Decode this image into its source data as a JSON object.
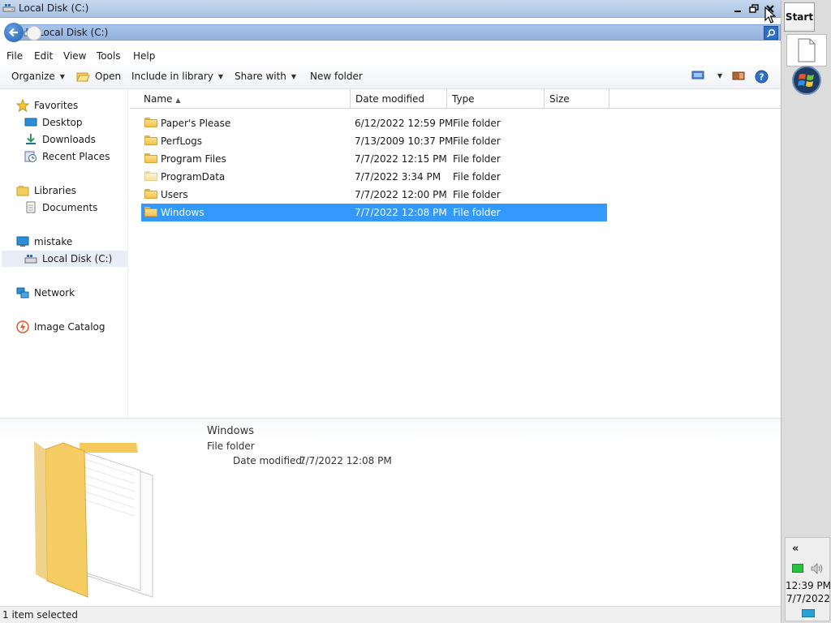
{
  "window": {
    "title": "Local Disk (C:)",
    "controls": {
      "minimize_icon": "minimize-icon",
      "maximize_icon": "restore-icon",
      "close_icon": "close-icon"
    }
  },
  "address": {
    "path": "Local Disk (C:)",
    "back_icon": "back-arrow-icon",
    "search_icon": "search-icon"
  },
  "menu": {
    "items": [
      "File",
      "Edit",
      "View",
      "Tools",
      "Help"
    ]
  },
  "toolbar": {
    "organize": "Organize",
    "open": "Open",
    "include_in_library": "Include in library",
    "share_with": "Share with",
    "new_folder": "New folder"
  },
  "nav": {
    "favorites": "Favorites",
    "desktop": "Desktop",
    "downloads": "Downloads",
    "recent_places": "Recent Places",
    "libraries": "Libraries",
    "documents": "Documents",
    "computer": "mistake",
    "local_disk": "Local Disk (C:)",
    "network": "Network",
    "image_catalog": "Image Catalog"
  },
  "columns": {
    "name": "Name",
    "date": "Date modified",
    "type": "Type",
    "size": "Size"
  },
  "files": [
    {
      "name": "Paper's Please",
      "date": "6/12/2022 12:59 PM",
      "type": "File folder"
    },
    {
      "name": "PerfLogs",
      "date": "7/13/2009 10:37 PM",
      "type": "File folder"
    },
    {
      "name": "Program Files",
      "date": "7/7/2022 12:15 PM",
      "type": "File folder"
    },
    {
      "name": "ProgramData",
      "date": "7/7/2022 3:34 PM",
      "type": "File folder"
    },
    {
      "name": "Users",
      "date": "7/7/2022 12:00 PM",
      "type": "File folder"
    },
    {
      "name": "Windows",
      "date": "7/7/2022 12:08 PM",
      "type": "File folder"
    }
  ],
  "selected_index": 5,
  "details": {
    "name": "Windows",
    "type": "File folder",
    "date_label": "Date modified:",
    "date_value": "7/7/2022 12:08 PM"
  },
  "status": {
    "text": "1 item selected"
  },
  "taskbar": {
    "start": "Start",
    "tray_chevron": "«",
    "time": "12:39 PM",
    "date": "7/7/2022"
  },
  "colors": {
    "selection": "#3399ff",
    "titlebar": "#c7d9ef",
    "folder": "#f2c14e"
  }
}
